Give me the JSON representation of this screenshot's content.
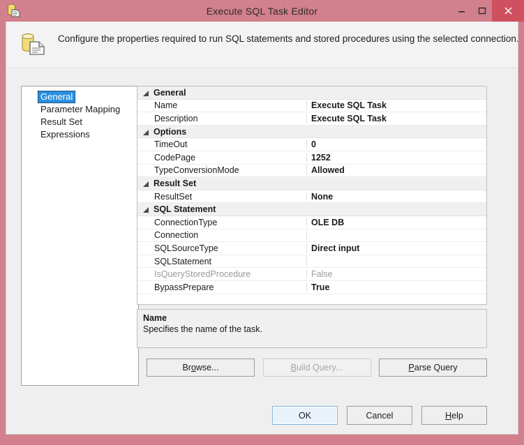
{
  "window": {
    "title": "Execute SQL Task Editor",
    "icon": "sql-task-icon",
    "controls": {
      "minimize_label": "Minimize",
      "maximize_label": "Maximize",
      "close_label": "Close"
    },
    "colors": {
      "titlebar": "#d2808d",
      "close_button": "#cf5160",
      "selection": "#2a8fe0",
      "default_button_border": "#7eb4e2"
    }
  },
  "banner": {
    "icon": "sql-task-banner-icon",
    "text": "Configure the properties required to run SQL statements and stored procedures using the selected connection."
  },
  "sidebar": {
    "items": [
      {
        "label": "General",
        "selected": true
      },
      {
        "label": "Parameter Mapping",
        "selected": false
      },
      {
        "label": "Result Set",
        "selected": false
      },
      {
        "label": "Expressions",
        "selected": false
      }
    ]
  },
  "grid": {
    "rows": [
      {
        "type": "category",
        "name": "General"
      },
      {
        "type": "property",
        "name": "Name",
        "value": "Execute SQL Task",
        "disabled": false
      },
      {
        "type": "property",
        "name": "Description",
        "value": "Execute SQL Task",
        "disabled": false
      },
      {
        "type": "category",
        "name": "Options"
      },
      {
        "type": "property",
        "name": "TimeOut",
        "value": "0",
        "disabled": false
      },
      {
        "type": "property",
        "name": "CodePage",
        "value": "1252",
        "disabled": false
      },
      {
        "type": "property",
        "name": "TypeConversionMode",
        "value": "Allowed",
        "disabled": false
      },
      {
        "type": "category",
        "name": "Result Set"
      },
      {
        "type": "property",
        "name": "ResultSet",
        "value": "None",
        "disabled": false
      },
      {
        "type": "category",
        "name": "SQL Statement"
      },
      {
        "type": "property",
        "name": "ConnectionType",
        "value": "OLE DB",
        "disabled": false
      },
      {
        "type": "property",
        "name": "Connection",
        "value": "",
        "disabled": false
      },
      {
        "type": "property",
        "name": "SQLSourceType",
        "value": "Direct input",
        "disabled": false
      },
      {
        "type": "property",
        "name": "SQLStatement",
        "value": "",
        "disabled": false
      },
      {
        "type": "property",
        "name": "IsQueryStoredProcedure",
        "value": "False",
        "disabled": true
      },
      {
        "type": "property",
        "name": "BypassPrepare",
        "value": "True",
        "disabled": false
      }
    ]
  },
  "description": {
    "title": "Name",
    "body": "Specifies the name of the task."
  },
  "mid_buttons": [
    {
      "id": "browse",
      "label": "Browse...",
      "accel": "w",
      "disabled": false
    },
    {
      "id": "build-query",
      "label": "Build Query...",
      "accel": "B",
      "disabled": true
    },
    {
      "id": "parse-query",
      "label": "Parse Query",
      "accel": "P",
      "disabled": false
    }
  ],
  "bottom_buttons": [
    {
      "id": "ok",
      "label": "OK",
      "accel": "",
      "default": true
    },
    {
      "id": "cancel",
      "label": "Cancel",
      "accel": "",
      "default": false
    },
    {
      "id": "help",
      "label": "Help",
      "accel": "H",
      "default": false
    }
  ]
}
